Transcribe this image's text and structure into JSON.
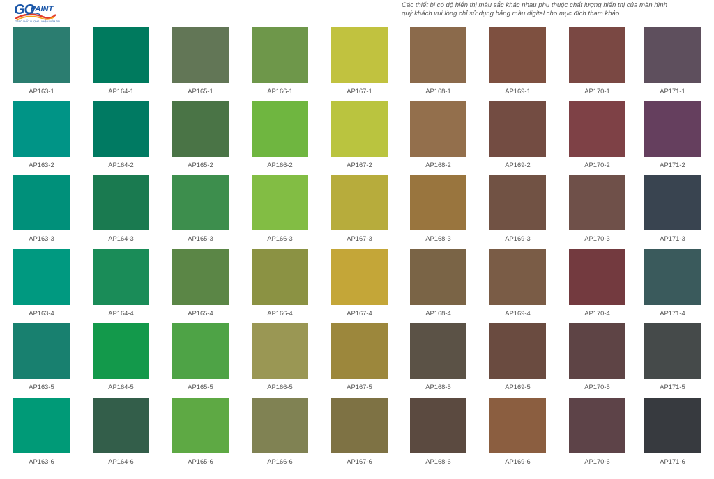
{
  "header": {
    "logo_text_go": "GO",
    "logo_text_paint": "PAINT",
    "logo_tagline": "TRAO CHẤT LƯỢNG - NHẬN NIỀM TIN",
    "notice_line1": "Các thiết bị có độ hiển thị màu sắc khác nhau phụ thuộc chất lượng hiển thị của màn hình",
    "notice_line2": "quý khách vui lòng chỉ sử dụng bảng màu digital cho mục đích tham khảo.",
    "brand_color": "#1a56a8",
    "swoosh_colors": [
      "#e23b2c",
      "#f7a21b",
      "#1a56a8"
    ]
  },
  "palette": {
    "columns": [
      {
        "series": "AP163",
        "chips": [
          {
            "code": "AP163-1",
            "color": "#2b7d70"
          },
          {
            "code": "AP163-2",
            "color": "#009486"
          },
          {
            "code": "AP163-3",
            "color": "#00907a"
          },
          {
            "code": "AP163-4",
            "color": "#009980"
          },
          {
            "code": "AP163-5",
            "color": "#18806f"
          },
          {
            "code": "AP163-6",
            "color": "#009a77"
          }
        ]
      },
      {
        "series": "AP164",
        "chips": [
          {
            "code": "AP164-1",
            "color": "#007a5e"
          },
          {
            "code": "AP164-2",
            "color": "#007a62"
          },
          {
            "code": "AP164-3",
            "color": "#1a7a50"
          },
          {
            "code": "AP164-4",
            "color": "#1a8c58"
          },
          {
            "code": "AP164-5",
            "color": "#13994b"
          },
          {
            "code": "AP164-6",
            "color": "#335e4a"
          }
        ]
      },
      {
        "series": "AP165",
        "chips": [
          {
            "code": "AP165-1",
            "color": "#627656"
          },
          {
            "code": "AP165-2",
            "color": "#4a7446"
          },
          {
            "code": "AP165-3",
            "color": "#3d8e4d"
          },
          {
            "code": "AP165-4",
            "color": "#5b8646"
          },
          {
            "code": "AP165-5",
            "color": "#4ea346"
          },
          {
            "code": "AP165-6",
            "color": "#5ea944"
          }
        ]
      },
      {
        "series": "AP166",
        "chips": [
          {
            "code": "AP166-1",
            "color": "#6e974a"
          },
          {
            "code": "AP166-2",
            "color": "#6fb640"
          },
          {
            "code": "AP166-3",
            "color": "#82bd44"
          },
          {
            "code": "AP166-4",
            "color": "#8b9243"
          },
          {
            "code": "AP166-5",
            "color": "#9a9754"
          },
          {
            "code": "AP166-6",
            "color": "#808253"
          }
        ]
      },
      {
        "series": "AP167",
        "chips": [
          {
            "code": "AP167-1",
            "color": "#c1c23f"
          },
          {
            "code": "AP167-2",
            "color": "#bac43f"
          },
          {
            "code": "AP167-3",
            "color": "#b7ac3c"
          },
          {
            "code": "AP167-4",
            "color": "#c4a638"
          },
          {
            "code": "AP167-5",
            "color": "#9c873c"
          },
          {
            "code": "AP167-6",
            "color": "#7e7244"
          }
        ]
      },
      {
        "series": "AP168",
        "chips": [
          {
            "code": "AP168-1",
            "color": "#8b6a4b"
          },
          {
            "code": "AP168-2",
            "color": "#936f4c"
          },
          {
            "code": "AP168-3",
            "color": "#99753e"
          },
          {
            "code": "AP168-4",
            "color": "#7a6446"
          },
          {
            "code": "AP168-5",
            "color": "#5b5246"
          },
          {
            "code": "AP168-6",
            "color": "#5b4a40"
          }
        ]
      },
      {
        "series": "AP169",
        "chips": [
          {
            "code": "AP169-1",
            "color": "#7e5040"
          },
          {
            "code": "AP169-2",
            "color": "#734c42"
          },
          {
            "code": "AP169-3",
            "color": "#715244"
          },
          {
            "code": "AP169-4",
            "color": "#7a5c46"
          },
          {
            "code": "AP169-5",
            "color": "#6a4b40"
          },
          {
            "code": "AP169-6",
            "color": "#8b5e40"
          }
        ]
      },
      {
        "series": "AP170",
        "chips": [
          {
            "code": "AP170-1",
            "color": "#7a4843"
          },
          {
            "code": "AP170-2",
            "color": "#7e4146"
          },
          {
            "code": "AP170-3",
            "color": "#6f5049"
          },
          {
            "code": "AP170-4",
            "color": "#733a3f"
          },
          {
            "code": "AP170-5",
            "color": "#5e4445"
          },
          {
            "code": "AP170-6",
            "color": "#5d4348"
          }
        ]
      },
      {
        "series": "AP171",
        "chips": [
          {
            "code": "AP171-1",
            "color": "#5e4f5d"
          },
          {
            "code": "AP171-2",
            "color": "#653f5e"
          },
          {
            "code": "AP171-3",
            "color": "#394450"
          },
          {
            "code": "AP171-4",
            "color": "#3a5a5c"
          },
          {
            "code": "AP171-5",
            "color": "#454a4a"
          },
          {
            "code": "AP171-6",
            "color": "#373a3f"
          }
        ]
      }
    ]
  }
}
